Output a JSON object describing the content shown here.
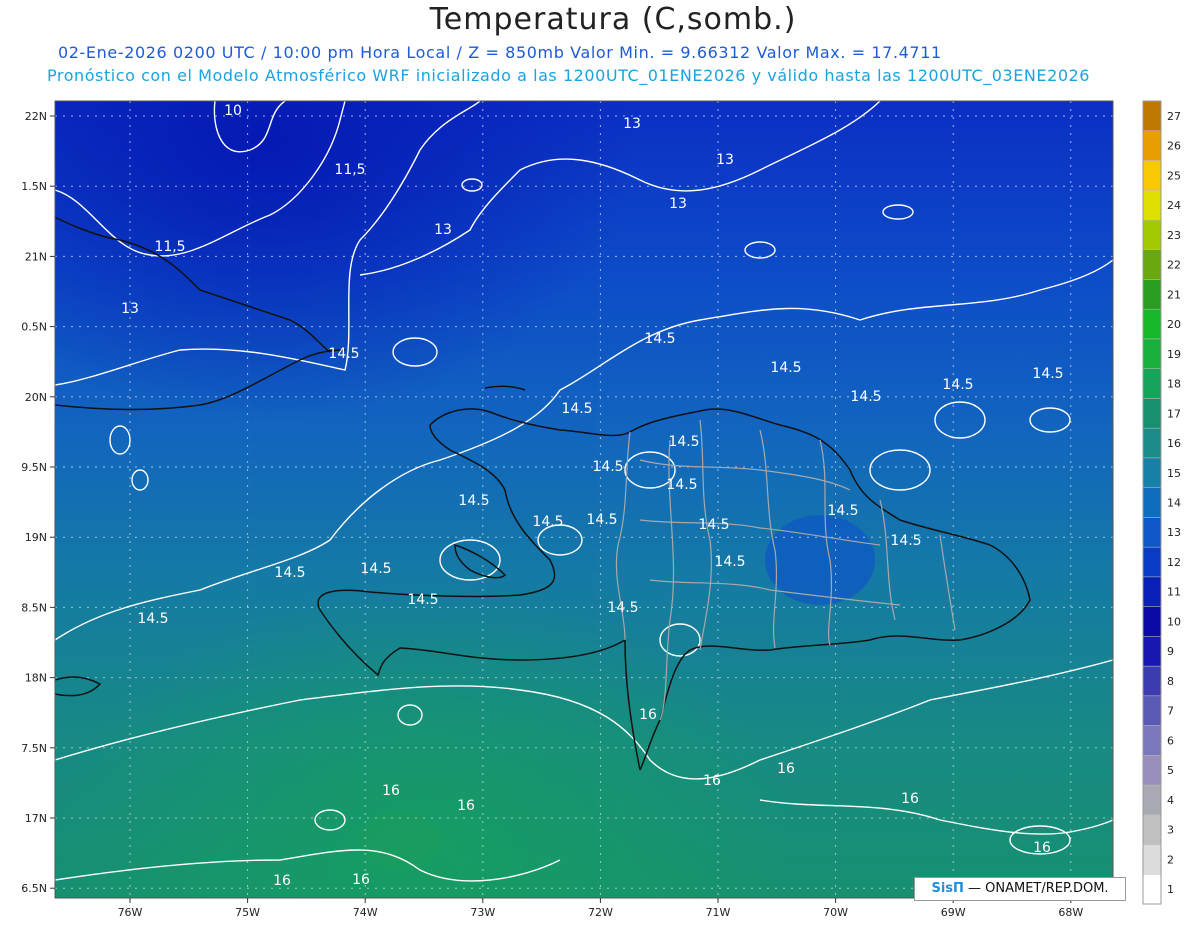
{
  "header": {
    "title": "Temperatura (C,somb.)",
    "line1": "02-Ene-2026  0200 UTC / 10:00 pm Hora Local / Z = 850mb    Valor Min. = 9.66312  Valor Max. = 17.4711",
    "line2": "Pronóstico con el Modelo Atmosférico WRF inicializado a las 1200UTC_01ENE2026 y válido hasta las  1200UTC_03ENE2026"
  },
  "axes": {
    "lat_labels": [
      "22N",
      "1.5N",
      "21N",
      "0.5N",
      "20N",
      "9.5N",
      "19N",
      "8.5N",
      "18N",
      "7.5N",
      "17N",
      "6.5N"
    ],
    "lon_labels": [
      "76W",
      "75W",
      "74W",
      "73W",
      "72W",
      "71W",
      "70W",
      "69W",
      "68W"
    ]
  },
  "colorbar": {
    "labels": [
      "1",
      "2",
      "3",
      "4",
      "5",
      "6",
      "7",
      "8",
      "9",
      "10",
      "11",
      "12",
      "13",
      "14",
      "15",
      "16",
      "17",
      "18",
      "19",
      "20",
      "21",
      "22",
      "23",
      "24",
      "25",
      "26",
      "27"
    ],
    "colors": [
      "#ffffff",
      "#dcdcdc",
      "#c0c0c0",
      "#a9a9b4",
      "#9a8fbc",
      "#7c78c0",
      "#5a5ab6",
      "#3c3cb0",
      "#1818b0",
      "#0a0aa8",
      "#0820b8",
      "#0b3cc8",
      "#0e57c8",
      "#0f6cbc",
      "#1680a6",
      "#1a8d8a",
      "#179070",
      "#16a35a",
      "#1ab040",
      "#17b82a",
      "#2a9e20",
      "#6aa810",
      "#a2c800",
      "#e0e000",
      "#f8c800",
      "#e8a000",
      "#c07800"
    ]
  },
  "contours": {
    "levels": [
      "10",
      "11,5",
      "13",
      "14.5",
      "16"
    ],
    "labels": [
      {
        "text": "10"
      },
      {
        "text": "11,5"
      },
      {
        "text": "11,5"
      },
      {
        "text": "13"
      },
      {
        "text": "13"
      },
      {
        "text": "13"
      },
      {
        "text": "13"
      },
      {
        "text": "13"
      },
      {
        "text": "14.5"
      },
      {
        "text": "14.5"
      },
      {
        "text": "14.5"
      },
      {
        "text": "14.5"
      },
      {
        "text": "14.5"
      },
      {
        "text": "14.5"
      },
      {
        "text": "14.5"
      },
      {
        "text": "14.5"
      },
      {
        "text": "14.5"
      },
      {
        "text": "14.5"
      },
      {
        "text": "14.5"
      },
      {
        "text": "14.5"
      },
      {
        "text": "14.5"
      },
      {
        "text": "14.5"
      },
      {
        "text": "14.5"
      },
      {
        "text": "14.5"
      },
      {
        "text": "14.5"
      },
      {
        "text": "14.5"
      },
      {
        "text": "14.5"
      },
      {
        "text": "14.5"
      },
      {
        "text": "14.5"
      },
      {
        "text": "14.5"
      },
      {
        "text": "16"
      },
      {
        "text": "16"
      },
      {
        "text": "16"
      },
      {
        "text": "16"
      },
      {
        "text": "16"
      },
      {
        "text": "16"
      },
      {
        "text": "16"
      },
      {
        "text": "16"
      },
      {
        "text": "16"
      }
    ]
  },
  "credit": {
    "brand": "SisΠ",
    "text": " — ONAMET/REP.DOM."
  }
}
